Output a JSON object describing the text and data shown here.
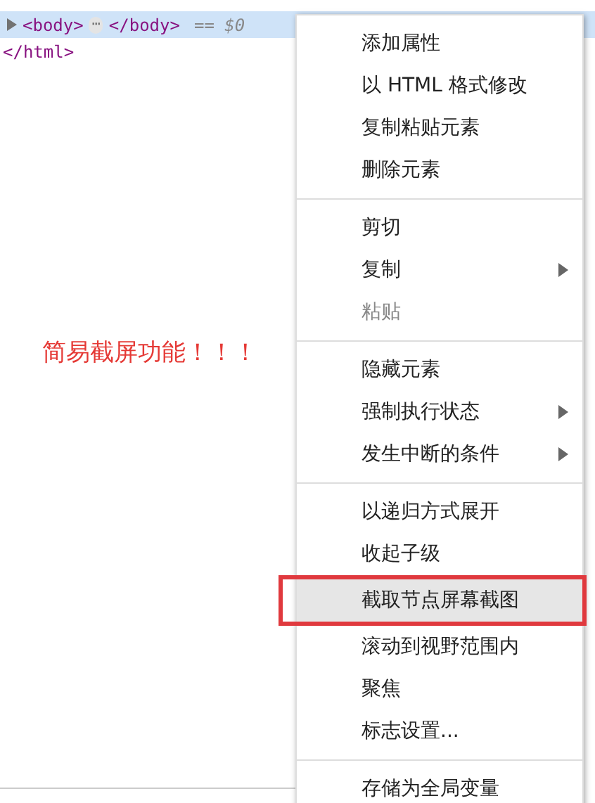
{
  "dom_tree": {
    "rows": [
      {
        "kind": "collapsed",
        "open_tag": "<body>",
        "ellipsis": "⋯",
        "close_tag": "</body>",
        "marker": "== $0",
        "selected": true
      },
      {
        "kind": "closing",
        "close_tag": "</html>",
        "selected": false
      }
    ]
  },
  "annotation": {
    "text": "简易截屏功能！！！"
  },
  "context_menu": {
    "groups": [
      {
        "items": [
          {
            "label": "添加属性",
            "disabled": false,
            "submenu": false,
            "selected": false,
            "framed": false
          },
          {
            "label": "以 HTML 格式修改",
            "disabled": false,
            "submenu": false,
            "selected": false,
            "framed": false
          },
          {
            "label": "复制粘贴元素",
            "disabled": false,
            "submenu": false,
            "selected": false,
            "framed": false
          },
          {
            "label": "删除元素",
            "disabled": false,
            "submenu": false,
            "selected": false,
            "framed": false
          }
        ]
      },
      {
        "items": [
          {
            "label": "剪切",
            "disabled": false,
            "submenu": false,
            "selected": false,
            "framed": false
          },
          {
            "label": "复制",
            "disabled": false,
            "submenu": true,
            "selected": false,
            "framed": false
          },
          {
            "label": "粘贴",
            "disabled": true,
            "submenu": false,
            "selected": false,
            "framed": false
          }
        ]
      },
      {
        "items": [
          {
            "label": "隐藏元素",
            "disabled": false,
            "submenu": false,
            "selected": false,
            "framed": false
          },
          {
            "label": "强制执行状态",
            "disabled": false,
            "submenu": true,
            "selected": false,
            "framed": false
          },
          {
            "label": "发生中断的条件",
            "disabled": false,
            "submenu": true,
            "selected": false,
            "framed": false
          }
        ]
      },
      {
        "items": [
          {
            "label": "以递归方式展开",
            "disabled": false,
            "submenu": false,
            "selected": false,
            "framed": false
          },
          {
            "label": "收起子级",
            "disabled": false,
            "submenu": false,
            "selected": false,
            "framed": false
          },
          {
            "label": "截取节点屏幕截图",
            "disabled": false,
            "submenu": false,
            "selected": true,
            "framed": true
          },
          {
            "label": "滚动到视野范围内",
            "disabled": false,
            "submenu": false,
            "selected": false,
            "framed": false
          },
          {
            "label": "聚焦",
            "disabled": false,
            "submenu": false,
            "selected": false,
            "framed": false
          },
          {
            "label": "标志设置...",
            "disabled": false,
            "submenu": false,
            "selected": false,
            "framed": false
          }
        ]
      },
      {
        "items": [
          {
            "label": "存储为全局变量",
            "disabled": false,
            "submenu": false,
            "selected": false,
            "framed": false
          }
        ]
      }
    ]
  }
}
